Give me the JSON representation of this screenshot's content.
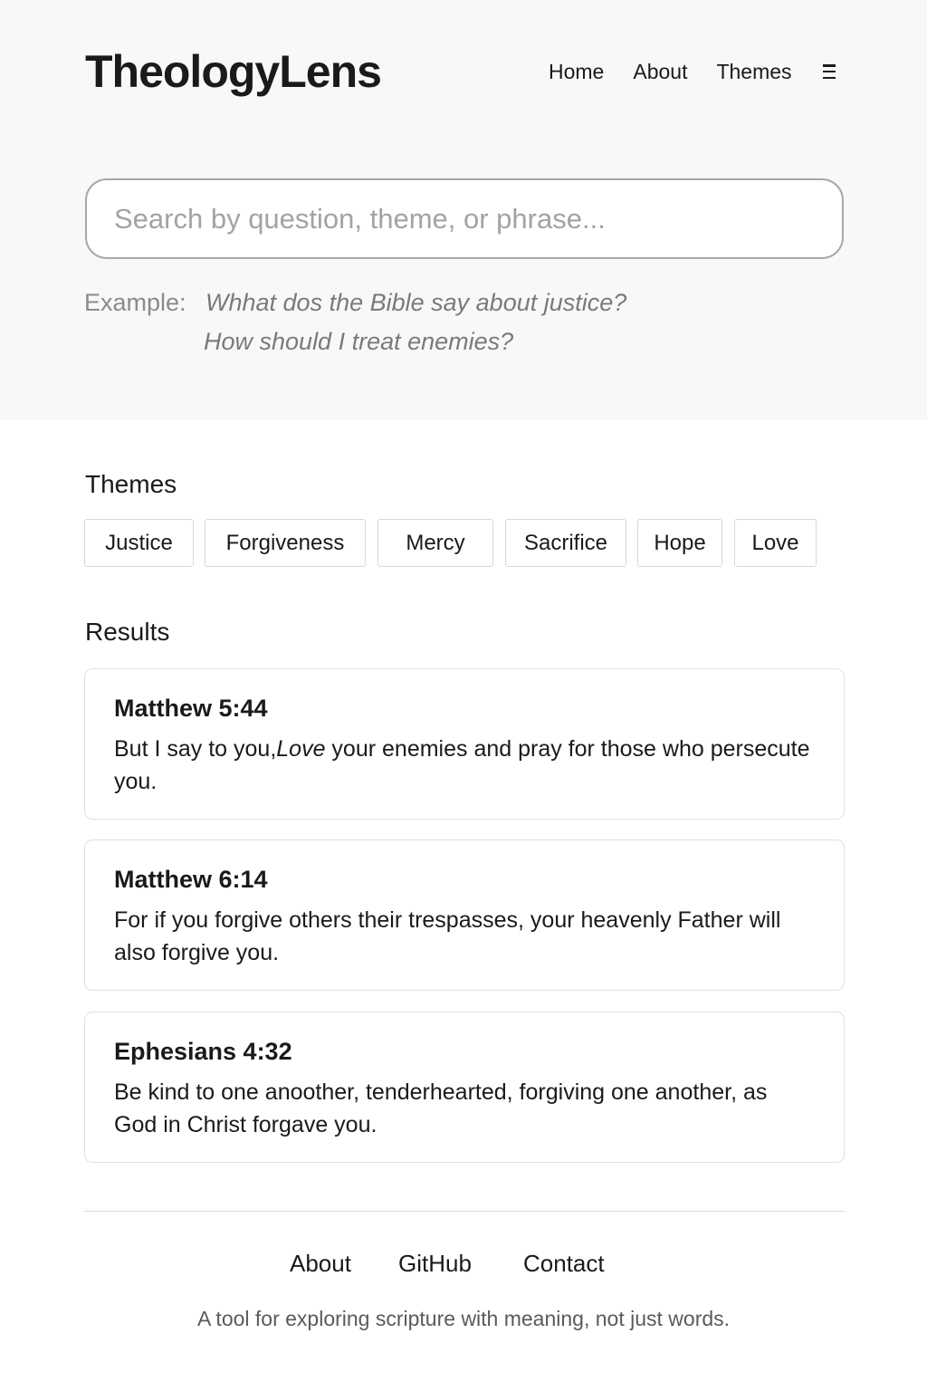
{
  "header": {
    "logo": "TheologyLens",
    "nav": [
      "Home",
      "About",
      "Themes"
    ],
    "menu_icon": "hamburger-menu-icon"
  },
  "search": {
    "placeholder": "Search by question, theme, or phrase...",
    "value": ""
  },
  "examples": {
    "label": "Example:",
    "items": [
      "Whhat dos the Bible say about justice?",
      "How should I treat enemies?"
    ]
  },
  "themes": {
    "title": "Themes",
    "items": [
      "Justice",
      "Forgiveness",
      "Mercy",
      "Sacrifice",
      "Hope",
      "Love"
    ]
  },
  "results": {
    "title": "Results",
    "items": [
      {
        "reference": "Matthew 5:44",
        "text_before": "But I say to you,",
        "text_emph": "Love",
        "text_after": " your enemies and pray for those who persecute you."
      },
      {
        "reference": "Matthew 6:14",
        "text": "For if you forgive others their trespasses, your heavenly Father will also forgive you."
      },
      {
        "reference": "Ephesians 4:32",
        "text": "Be kind to one anoother, tenderhearted, forgiving one another, as God in Christ forgave you."
      }
    ]
  },
  "footer": {
    "links": [
      "About",
      "GitHub",
      "Contact"
    ],
    "tagline": "A tool for exploring scripture with meaning, not just words."
  },
  "colors": {
    "hero_background": "#f8f8f8",
    "text": "#1a1a1a",
    "muted_text": "#8a8a8a",
    "border": "#d8d8d8"
  }
}
